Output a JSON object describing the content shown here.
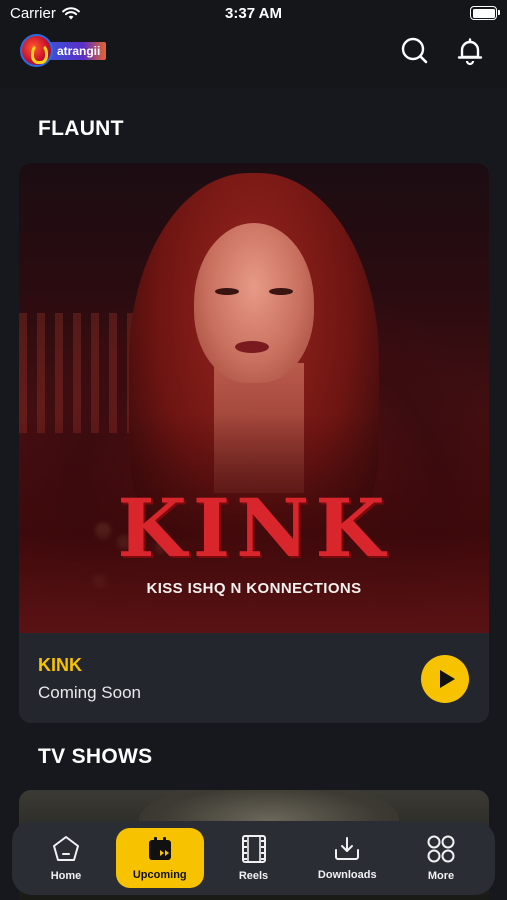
{
  "status_bar": {
    "carrier": "Carrier",
    "time": "3:37 AM"
  },
  "header": {
    "logo_text": "atrangii"
  },
  "sections": [
    {
      "title": "FLAUNT",
      "card": {
        "poster_title": "KINK",
        "poster_subtitle": "KISS ISHQ N KONNECTIONS",
        "title": "KINK",
        "subtitle": "Coming Soon"
      }
    },
    {
      "title": "TV SHOWS"
    }
  ],
  "bottom_nav": [
    {
      "label": "Home",
      "icon": "home-icon",
      "active": false
    },
    {
      "label": "Upcoming",
      "icon": "calendar-play-icon",
      "active": true
    },
    {
      "label": "Reels",
      "icon": "film-reel-icon",
      "active": false
    },
    {
      "label": "Downloads",
      "icon": "download-icon",
      "active": false
    },
    {
      "label": "More",
      "icon": "grid-icon",
      "active": false
    }
  ],
  "colors": {
    "accent": "#f7c300",
    "background": "#17181d",
    "card": "#24262e",
    "nav": "#2b2d35"
  }
}
